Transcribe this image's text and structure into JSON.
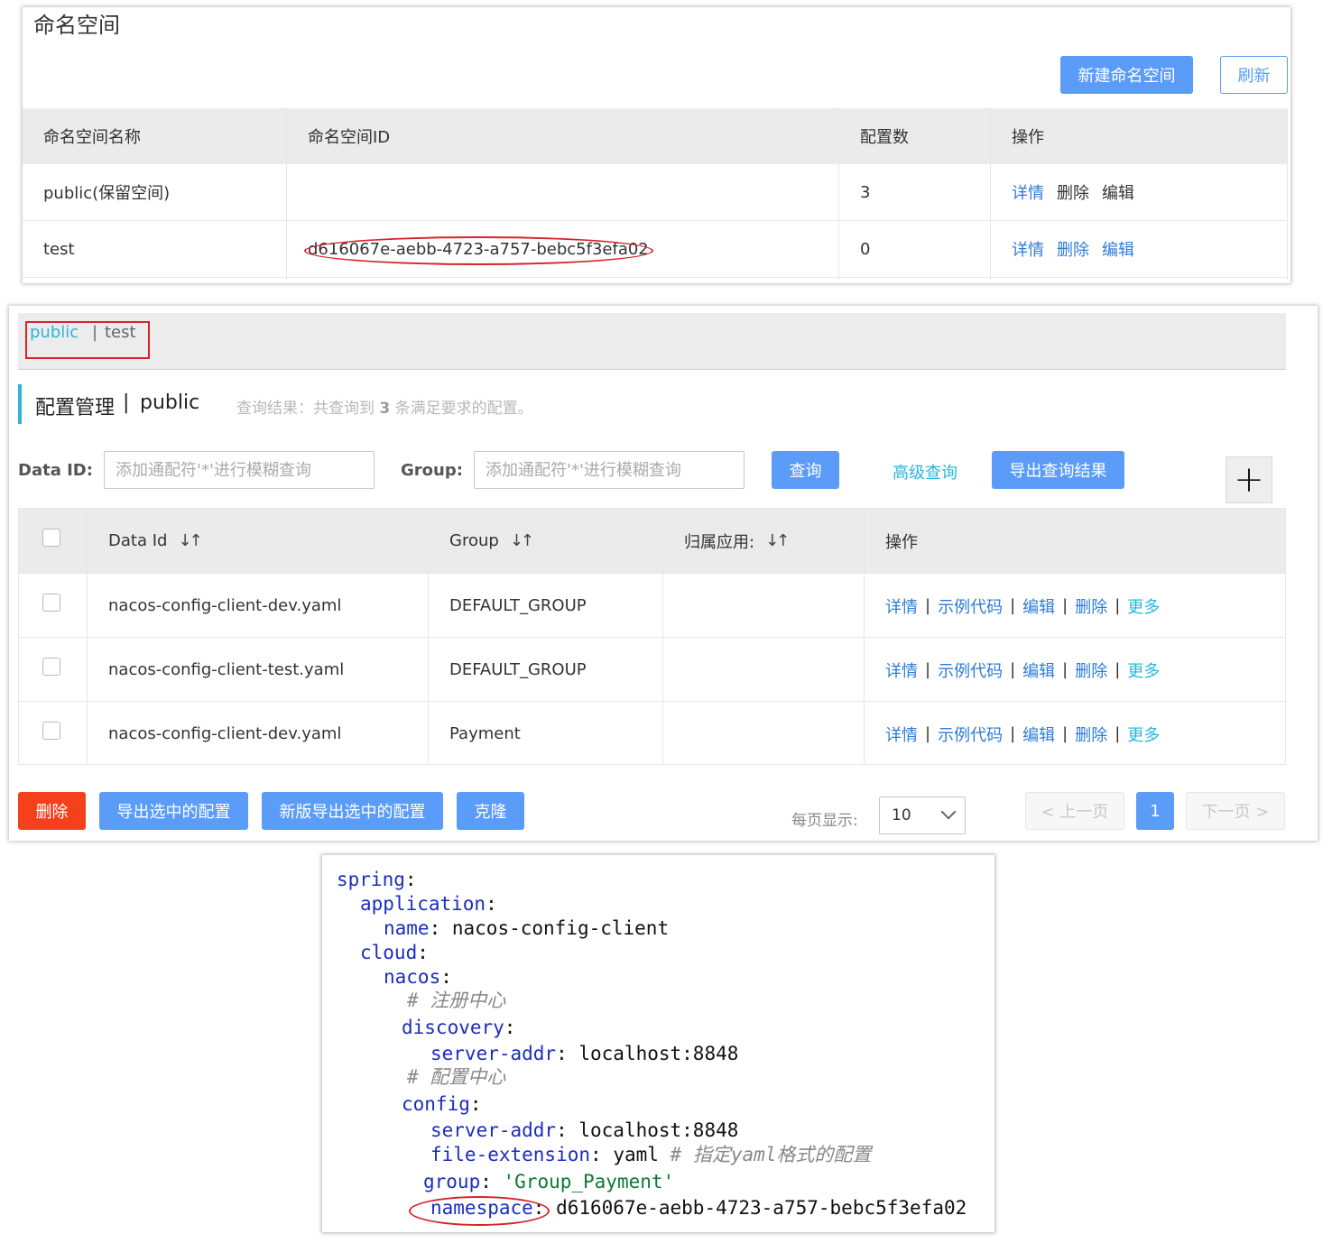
{
  "namespace_panel": {
    "title": "命名空间",
    "new_button": "新建命名空间",
    "refresh_button": "刷新",
    "columns": [
      "命名空间名称",
      "命名空间ID",
      "配置数",
      "操作"
    ],
    "rows": [
      {
        "name": "public(保留空间)",
        "id": "",
        "count": "3",
        "actions": [
          "详情",
          "删除",
          "编辑"
        ]
      },
      {
        "name": "test",
        "id": "d616067e-aebb-4723-a757-bebc5f3efa02",
        "count": "0",
        "actions": [
          "详情",
          "删除",
          "编辑"
        ]
      }
    ]
  },
  "config_panel": {
    "ns_tabs": {
      "public": "public",
      "separator": "|",
      "test": "test"
    },
    "header": {
      "title": "配置管理",
      "separator": "|",
      "namespace": "public",
      "summary_prefix": "查询结果：共查询到 ",
      "summary_count": "3",
      "summary_suffix": " 条满足要求的配置。"
    },
    "filters": {
      "data_id_label": "Data ID:",
      "data_id_placeholder": "添加通配符'*'进行模糊查询",
      "group_label": "Group:",
      "group_placeholder": "添加通配符'*'进行模糊查询",
      "query_button": "查询",
      "advanced_link": "高级查询",
      "export_button": "导出查询结果",
      "add_symbol": "+"
    },
    "columns": [
      "Data Id",
      "Group",
      "归属应用:",
      "操作"
    ],
    "sort_symbol": "↓↑",
    "rows": [
      {
        "data_id": "nacos-config-client-dev.yaml",
        "group": "DEFAULT_GROUP",
        "app": ""
      },
      {
        "data_id": "nacos-config-client-test.yaml",
        "group": "DEFAULT_GROUP",
        "app": ""
      },
      {
        "data_id": "nacos-config-client-dev.yaml",
        "group": "Payment",
        "app": ""
      }
    ],
    "row_actions": {
      "detail": "详情",
      "sample": "示例代码",
      "edit": "编辑",
      "delete": "删除",
      "more": "更多",
      "sep": "|"
    },
    "footer": {
      "delete_button": "删除",
      "export_selected_button": "导出选中的配置",
      "new_export_button": "新版导出选中的配置",
      "clone_button": "克隆",
      "page_size_label": "每页显示:",
      "page_size_value": "10",
      "prev_button": "< 上一页",
      "current_page": "1",
      "next_button": "下一页 >"
    }
  },
  "code_panel": {
    "lines": [
      {
        "key": "spring",
        "colon": ":"
      },
      {
        "key": "application",
        "colon": ":"
      },
      {
        "key": "name",
        "colon": ": ",
        "value": "nacos-config-client"
      },
      {
        "key": "cloud",
        "colon": ":"
      },
      {
        "key": "nacos",
        "colon": ":"
      },
      {
        "comment": "# 注册中心"
      },
      {
        "key": "discovery",
        "colon": ":"
      },
      {
        "key": "server-addr",
        "colon": ": ",
        "value": "localhost:8848"
      },
      {
        "comment": "# 配置中心"
      },
      {
        "key": "config",
        "colon": ":"
      },
      {
        "key": "server-addr",
        "colon": ": ",
        "value": "localhost:8848"
      },
      {
        "key": "file-extension",
        "colon": ": ",
        "value": "yaml ",
        "comment": "# 指定yaml格式的配置"
      },
      {
        "key": "group",
        "colon": ": ",
        "string": "'Group_Payment'"
      },
      {
        "key": "namespace",
        "colon": ": ",
        "value": "d616067e-aebb-4723-a757-bebc5f3efa02"
      }
    ]
  },
  "colors": {
    "primary": "#5a9cf8",
    "danger": "#f5401c",
    "link": "#2f7bd6",
    "accent": "#2eb5d8",
    "highlight": "#d8232a"
  }
}
